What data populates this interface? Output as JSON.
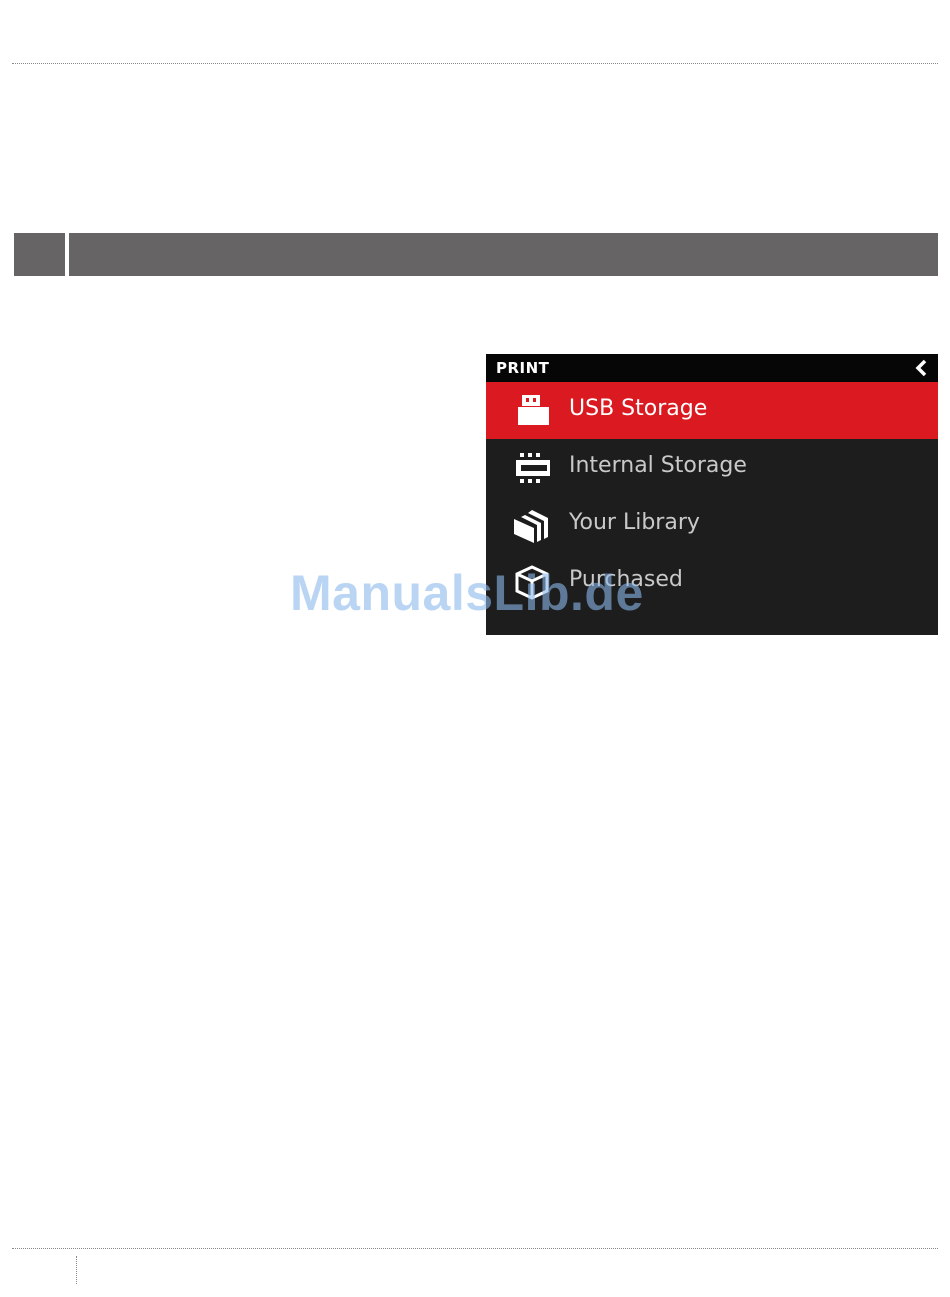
{
  "screen": {
    "title": "PRINT",
    "back_icon": "chevron-left-icon",
    "accent_color": "#da1a20",
    "background_color": "#1d1d1d",
    "items": [
      {
        "label": "USB Storage",
        "icon": "usb-drive-icon",
        "selected": true
      },
      {
        "label": "Internal Storage",
        "icon": "internal-storage-icon",
        "selected": false
      },
      {
        "label": "Your Library",
        "icon": "library-icon",
        "selected": false
      },
      {
        "label": "Purchased",
        "icon": "purchased-box-icon",
        "selected": false
      }
    ]
  },
  "watermark": "ManualsLib.de"
}
